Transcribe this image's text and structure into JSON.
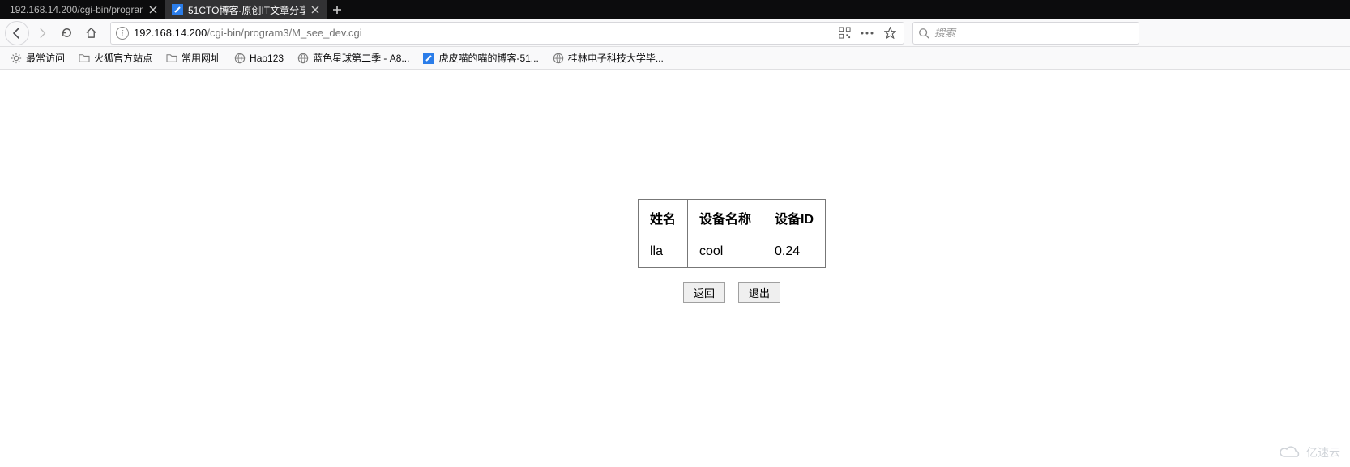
{
  "tabs": [
    {
      "label": "192.168.14.200/cgi-bin/program",
      "active": false
    },
    {
      "label": "51CTO博客-原创IT文章分享平",
      "active": true
    }
  ],
  "url": {
    "host": "192.168.14.200",
    "path": "/cgi-bin/program3/M_see_dev.cgi"
  },
  "search": {
    "placeholder": "搜索"
  },
  "bookmarks": {
    "most_visited": "最常访问",
    "items": [
      {
        "label": "火狐官方站点",
        "type": "folder"
      },
      {
        "label": "常用网址",
        "type": "folder"
      },
      {
        "label": "Hao123",
        "type": "globe"
      },
      {
        "label": "蓝色星球第二季 - A8...",
        "type": "globe"
      },
      {
        "label": "虎皮喵的喵的博客-51...",
        "type": "site"
      },
      {
        "label": "桂林电子科技大学毕...",
        "type": "globe"
      }
    ]
  },
  "table": {
    "headers": [
      "姓名",
      "设备名称",
      "设备ID"
    ],
    "rows": [
      [
        "lla",
        "cool",
        "0.24"
      ]
    ]
  },
  "buttons": {
    "back": "返回",
    "exit": "退出"
  },
  "watermark": "亿速云"
}
